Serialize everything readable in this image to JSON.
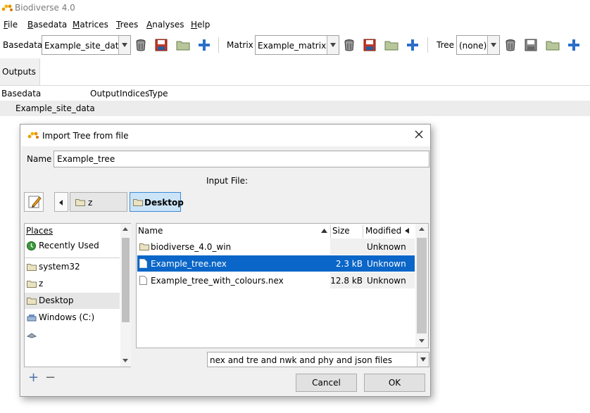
{
  "window": {
    "title": "Biodiverse 4.0"
  },
  "menubar": {
    "items": [
      "File",
      "Basedata",
      "Matrices",
      "Trees",
      "Analyses",
      "Help"
    ]
  },
  "toolbar": {
    "basedata_label": "Basedata",
    "basedata_value": "Example_site_data",
    "matrix_label": "Matrix",
    "matrix_value": "Example_matrix",
    "tree_label": "Tree",
    "tree_value": "(none)",
    "icons": [
      "delete-icon",
      "save-icon",
      "open-folder-icon",
      "add-icon"
    ]
  },
  "tabs": {
    "outputs": "Outputs"
  },
  "outputs_table": {
    "columns": [
      "Basedata",
      "Output",
      "Indices",
      "Type"
    ],
    "rows": [
      {
        "basedata": "Example_site_data"
      }
    ]
  },
  "dialog": {
    "title": "Import Tree from file",
    "name_label": "Name",
    "name_value": "Example_tree",
    "input_file_label": "Input File:",
    "breadcrumbs": [
      "z",
      "Desktop"
    ],
    "places_header": "Places",
    "places": [
      {
        "label": "Recently Used",
        "icon": "recent-icon"
      },
      {
        "label": "system32",
        "icon": "folder-icon"
      },
      {
        "label": "z",
        "icon": "folder-icon"
      },
      {
        "label": "Desktop",
        "icon": "folder-icon"
      },
      {
        "label": "Windows (C:)",
        "icon": "drive-icon"
      }
    ],
    "files_columns": {
      "name": "Name",
      "size": "Size",
      "modified": "Modified"
    },
    "files": [
      {
        "name": "biodiverse_4.0_win",
        "size": "",
        "modified": "Unknown",
        "icon": "folder-icon"
      },
      {
        "name": "Example_tree.nex",
        "size": "2.3 kB",
        "modified": "Unknown",
        "icon": "file-icon"
      },
      {
        "name": "Example_tree_with_colours.nex",
        "size": "12.8 kB",
        "modified": "Unknown",
        "icon": "file-icon"
      }
    ],
    "filter_value": "nex and tre and nwk and phy and json files",
    "cancel_label": "Cancel",
    "ok_label": "OK",
    "add_place": "+",
    "remove_place": "−"
  }
}
